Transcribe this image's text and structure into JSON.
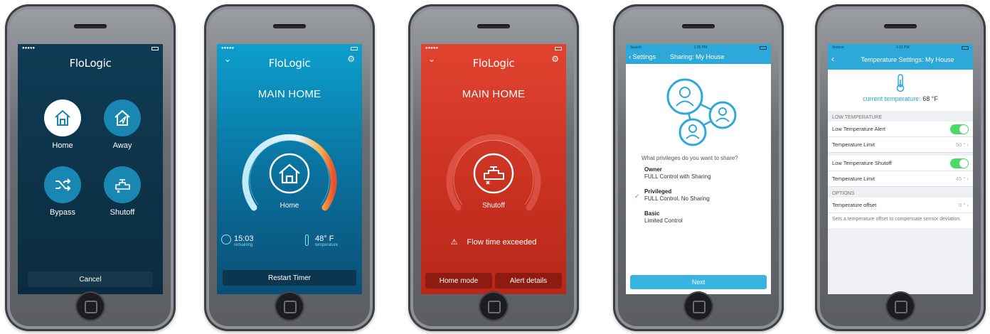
{
  "phone1": {
    "logo": "FloLogic",
    "modes": [
      {
        "label": "Home",
        "selected": true
      },
      {
        "label": "Away",
        "selected": false
      },
      {
        "label": "Bypass",
        "selected": false
      },
      {
        "label": "Shutoff",
        "selected": false
      }
    ],
    "cancel_label": "Cancel"
  },
  "phone2": {
    "logo": "FloLogic",
    "title": "MAIN HOME",
    "mode_label": "Home",
    "time_value": "15:03",
    "time_caption": "remaining",
    "temp_value": "48° F",
    "temp_caption": "temperature",
    "button_label": "Restart Timer"
  },
  "phone3": {
    "logo": "FloLogic",
    "title": "MAIN HOME",
    "mode_label": "Shutoff",
    "alert_text": "Flow time exceeded",
    "left_button": "Home mode",
    "right_button": "Alert details"
  },
  "phone4": {
    "status_left": "Search",
    "status_time": "1:26 PM",
    "back_label": "Settings",
    "title": "Sharing: My House",
    "question": "What privileges do you want to share?",
    "options": [
      {
        "name": "Owner",
        "desc": "FULL Control with Sharing",
        "checked": false
      },
      {
        "name": "Privileged",
        "desc": "FULL Control, No Sharing",
        "checked": true
      },
      {
        "name": "Basic",
        "desc": "Limited Control",
        "checked": false
      }
    ],
    "next_label": "Next"
  },
  "phone5": {
    "status_left": "Verizon",
    "status_time": "1:31 PM",
    "title": "Temperature Settings: My House",
    "current_label": "current temperature:",
    "current_value": "68 °F",
    "section_low": "LOW TEMPERATURE",
    "row_alert": "Low Temperature Alert",
    "row_limit1": "Temperature Limit",
    "row_limit1_val": "50 °",
    "row_shutoff": "Low Temperature Shutoff",
    "row_limit2": "Temperature Limit",
    "row_limit2_val": "45 °",
    "section_options": "OPTIONS",
    "row_offset": "Temperature offset",
    "row_offset_val": "0 °",
    "note": "Sets a temperature offset to compensate sensor deviation.",
    "accent": "#2ea8d8"
  }
}
